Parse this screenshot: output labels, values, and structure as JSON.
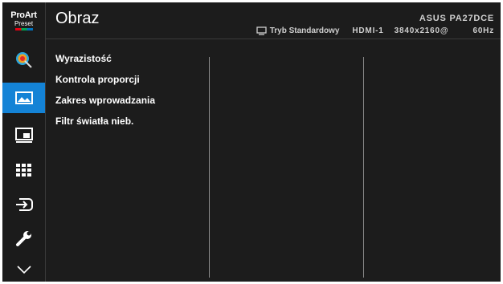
{
  "logo": {
    "line1": "ProArt",
    "line2": "Preset"
  },
  "sidebar": {
    "items": [
      {
        "name": "color-preset",
        "icon": "palette-icon",
        "active": false
      },
      {
        "name": "image",
        "icon": "image-icon",
        "active": true
      },
      {
        "name": "pip-pbp",
        "icon": "pip-icon",
        "active": false
      },
      {
        "name": "color",
        "icon": "grid-icon",
        "active": false
      },
      {
        "name": "input-select",
        "icon": "input-icon",
        "active": false
      },
      {
        "name": "system-setup",
        "icon": "wrench-icon",
        "active": false
      },
      {
        "name": "more",
        "icon": "chevron-down-icon",
        "active": false
      }
    ]
  },
  "header": {
    "title": "Obraz",
    "model": "ASUS PA27DCE",
    "mode_label": "Tryb Standardowy",
    "input": "HDMI-1",
    "resolution": "3840x2160@",
    "refresh": "60Hz"
  },
  "menu": {
    "items": [
      "Wyrazistość",
      "Kontrola proporcji",
      "Zakres wprowadzania",
      "Filtr światła nieb."
    ]
  },
  "colors": {
    "accent": "#1483d6",
    "background": "#1c1c1c"
  }
}
